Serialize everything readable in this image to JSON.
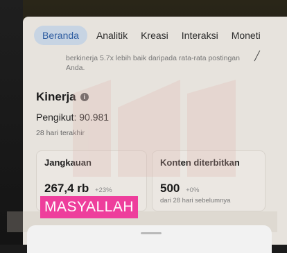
{
  "tabs": [
    {
      "label": "Beranda",
      "active": true
    },
    {
      "label": "Analitik",
      "active": false
    },
    {
      "label": "Kreasi",
      "active": false
    },
    {
      "label": "Interaksi",
      "active": false
    },
    {
      "label": "Moneti",
      "active": false
    }
  ],
  "notice": {
    "text": "berkinerja 5.7x lebih baik daripada rata-rata postingan Anda."
  },
  "performance": {
    "title": "Kinerja",
    "followers": "Pengikut: 90.981",
    "period": "28 hari terakhir"
  },
  "cards": [
    {
      "title": "Jangkauan",
      "value": "267,4 rb",
      "delta": "+23%",
      "sub": ""
    },
    {
      "title": "Konten diterbitkan",
      "value": "500",
      "delta": "+0%",
      "sub": "dari 28 hari sebelumnya"
    }
  ],
  "caption": {
    "text": "MASYALLAH"
  },
  "colors": {
    "active_tab_bg": "#c7d4e3",
    "active_tab_text": "#2d5ca0",
    "caption_bg": "#ee3e9c"
  }
}
